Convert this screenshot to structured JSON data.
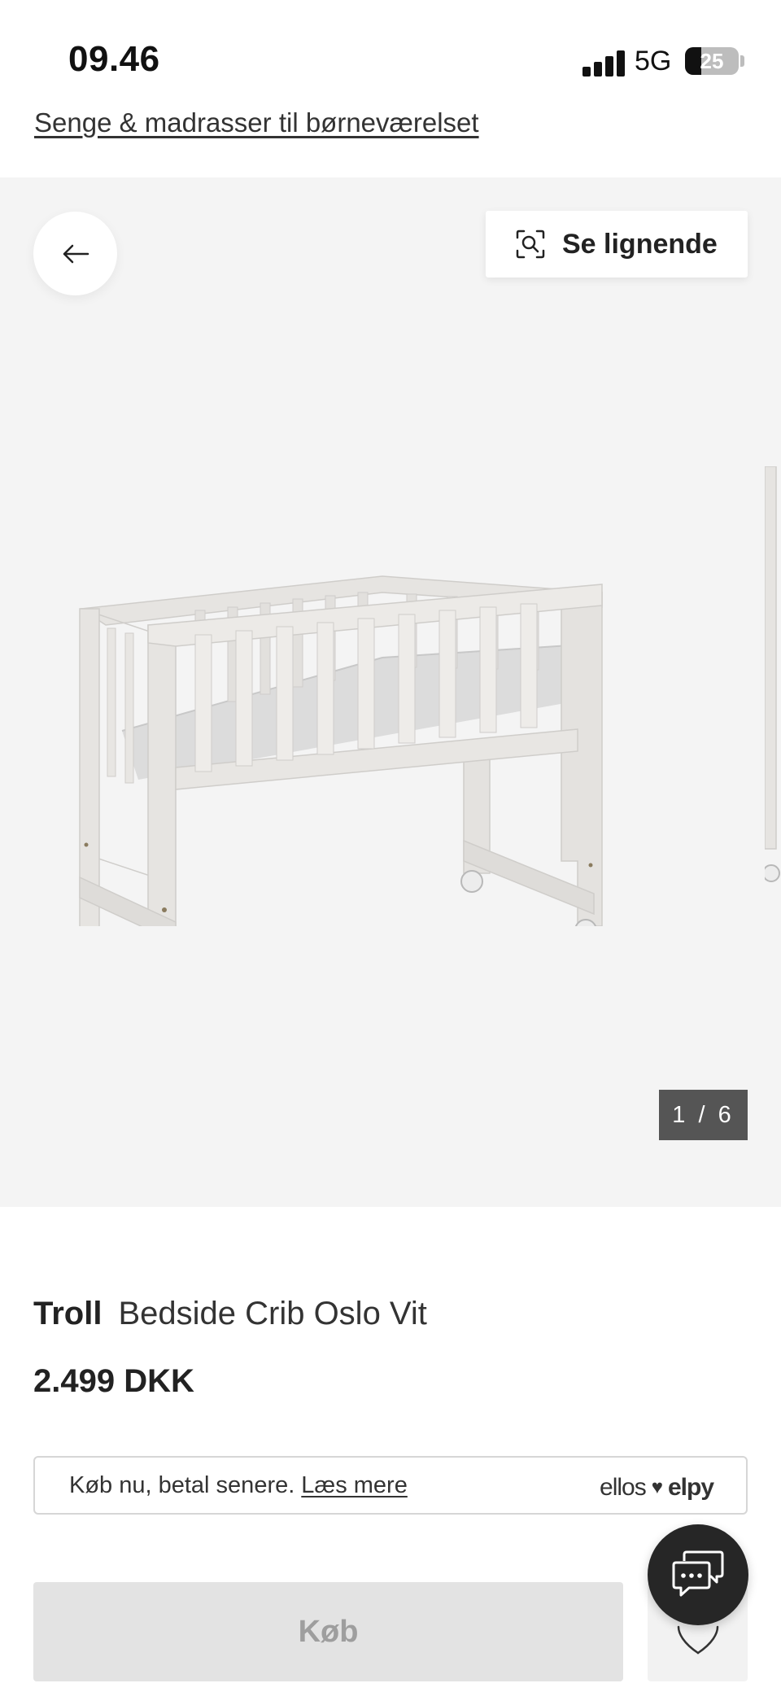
{
  "status_bar": {
    "time": "09.46",
    "network": "5G",
    "battery": "25"
  },
  "breadcrumb": "Senge & madrasser til børneværelset",
  "gallery": {
    "back_icon": "arrow-left-icon",
    "similar_label": "Se lignende",
    "similar_icon": "visual-search-icon",
    "counter": "1 / 6",
    "image_alt": "product-image-bedside-crib"
  },
  "product": {
    "brand": "Troll",
    "name": "Bedside Crib Oslo Vit",
    "price": "2.499 DKK"
  },
  "pay_later": {
    "text": "Køb nu, betal senere.",
    "link": "Læs mere",
    "brand_left": "ellos",
    "brand_right": "elpy"
  },
  "actions": {
    "buy_label": "Køb",
    "wishlist_icon": "heart-icon",
    "chat_icon": "chat-icon"
  },
  "colors": {
    "gallery_bg": "#f4f4f4",
    "buy_disabled_bg": "#e3e3e3",
    "counter_bg": "#555555",
    "chat_bg": "#262626"
  }
}
